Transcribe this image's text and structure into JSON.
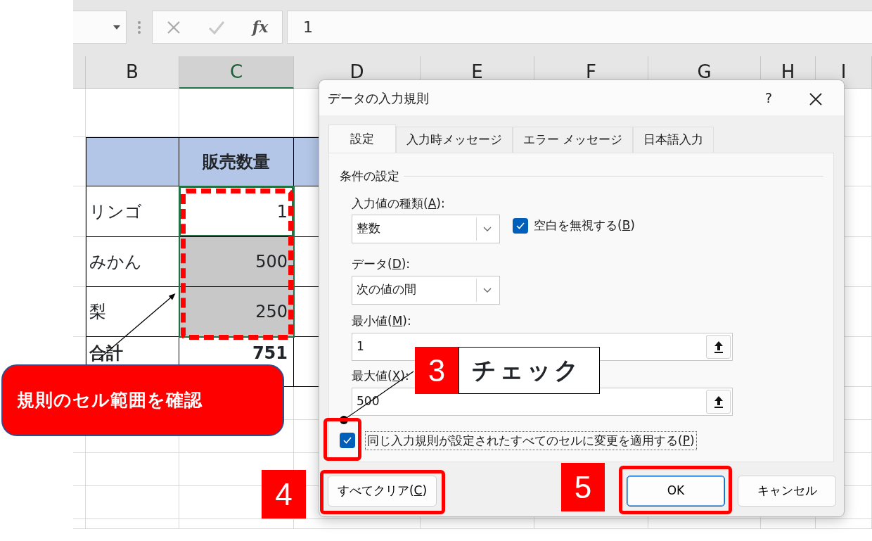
{
  "formula_bar": {
    "function_label": "fx",
    "formula": "1"
  },
  "columns": [
    {
      "label": "B",
      "selected": false
    },
    {
      "label": "C",
      "selected": true
    },
    {
      "label": "D",
      "selected": false
    },
    {
      "label": "E",
      "selected": false
    },
    {
      "label": "F",
      "selected": false
    },
    {
      "label": "G",
      "selected": false
    },
    {
      "label": "H",
      "selected": false
    },
    {
      "label": "I",
      "selected": false
    }
  ],
  "table": {
    "value_header": "販売数量",
    "rows": [
      {
        "kind": "item",
        "label": "リンゴ",
        "value": "1",
        "selected": true,
        "active": true
      },
      {
        "kind": "item",
        "label": "みかん",
        "value": "500",
        "selected": true,
        "active": false
      },
      {
        "kind": "item",
        "label": "梨",
        "value": "250",
        "selected": true,
        "active": false
      },
      {
        "kind": "total",
        "label": "合計",
        "value": "751",
        "selected": false,
        "active": false
      }
    ]
  },
  "dialog": {
    "title": "データの入力規則",
    "help": "?",
    "tabs": [
      {
        "label": "設定",
        "selected": true
      },
      {
        "label": "入力時メッセージ",
        "selected": false
      },
      {
        "label": "エラー メッセージ",
        "selected": false
      },
      {
        "label": "日本語入力",
        "selected": false
      }
    ],
    "section": "条件の設定",
    "allow": {
      "label_parts": [
        "入力値の種類(",
        "A",
        "):"
      ],
      "value": "整数"
    },
    "ignore_blank": {
      "label_parts": [
        "空白を無視する(",
        "B",
        ")"
      ],
      "checked": true
    },
    "data": {
      "label_parts": [
        "データ(",
        "D",
        "):"
      ],
      "value": "次の値の間"
    },
    "minimum": {
      "label_parts": [
        "最小値(",
        "M",
        "):"
      ],
      "value": "1"
    },
    "maximum": {
      "label_parts": [
        "最大値(",
        "X",
        "):"
      ],
      "value": "500"
    },
    "apply_all": {
      "label_parts": [
        "同じ入力規則が設定されたすべてのセルに変更を適用する(",
        "P",
        ")"
      ],
      "checked": true
    },
    "buttons": [
      {
        "kind": "clear",
        "label_parts": [
          "すべてクリア(",
          "C",
          ")"
        ]
      },
      {
        "kind": "ok",
        "label_parts": [
          "OK"
        ]
      },
      {
        "kind": "cancel",
        "label_parts": [
          "キャンセル"
        ]
      }
    ]
  },
  "annotations": {
    "callout": "規則のセル範囲を確認",
    "steps": [
      {
        "number": "3",
        "note": "チェック"
      },
      {
        "number": "4"
      },
      {
        "number": "5"
      }
    ]
  }
}
